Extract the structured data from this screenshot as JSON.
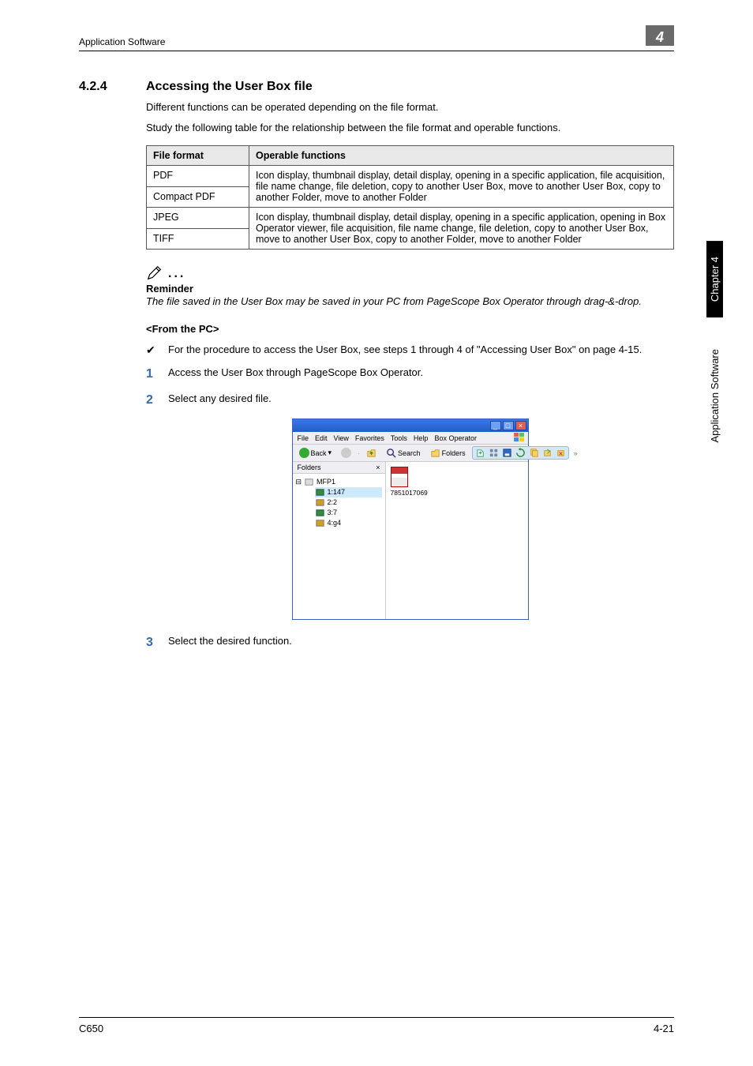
{
  "header": {
    "left": "Application Software",
    "chapter_tab": "4"
  },
  "section": {
    "number": "4.2.4",
    "title": "Accessing the User Box file"
  },
  "paragraphs": {
    "intro1": "Different functions can be operated depending on the file format.",
    "intro2": "Study the following table for the relationship between the file format and operable functions."
  },
  "table": {
    "headers": [
      "File format",
      "Operable functions"
    ],
    "rows": [
      {
        "fmt": "PDF",
        "ops": "Icon display, thumbnail display, detail display, opening in a specific application, file acquisition, file name change, file deletion, copy to another User Box, move to another User Box, copy to another Folder, move to another Folder"
      },
      {
        "fmt": "Compact PDF",
        "ops": ""
      },
      {
        "fmt": "JPEG",
        "ops": "Icon display, thumbnail display, detail display, opening in a specific application, opening in Box Operator viewer, file acquisition, file name change, file deletion, copy to another User Box, move to another User Box, copy to another Folder, move to another Folder"
      },
      {
        "fmt": "TIFF",
        "ops": ""
      }
    ]
  },
  "reminder": {
    "title": "Reminder",
    "body": "The file saved in the User Box may be saved in your PC from PageScope Box Operator through drag-&-drop."
  },
  "subhead": "<From the PC>",
  "checklist": {
    "item": "For the procedure to access the User Box, see steps 1 through 4 of \"Accessing User Box\" on page 4-15."
  },
  "steps": {
    "s1": {
      "n": "1",
      "t": "Access the User Box through PageScope Box Operator."
    },
    "s2": {
      "n": "2",
      "t": "Select any desired file."
    },
    "s3": {
      "n": "3",
      "t": "Select the desired function."
    }
  },
  "screenshot": {
    "menus": [
      "File",
      "Edit",
      "View",
      "Favorites",
      "Tools",
      "Help",
      "Box Operator"
    ],
    "toolbar": {
      "back": "Back",
      "search": "Search",
      "folders": "Folders"
    },
    "folders_panel_title": "Folders",
    "close_glyph": "×",
    "tree": {
      "root": "MFP1",
      "items": [
        {
          "label": "1:147"
        },
        {
          "label": "2:2"
        },
        {
          "label": "3:7"
        },
        {
          "label": "4:g4"
        }
      ]
    },
    "file_label": "7851017069"
  },
  "side": {
    "black": "Chapter 4",
    "text": "Application Software"
  },
  "footer": {
    "left": "C650",
    "right": "4-21"
  }
}
